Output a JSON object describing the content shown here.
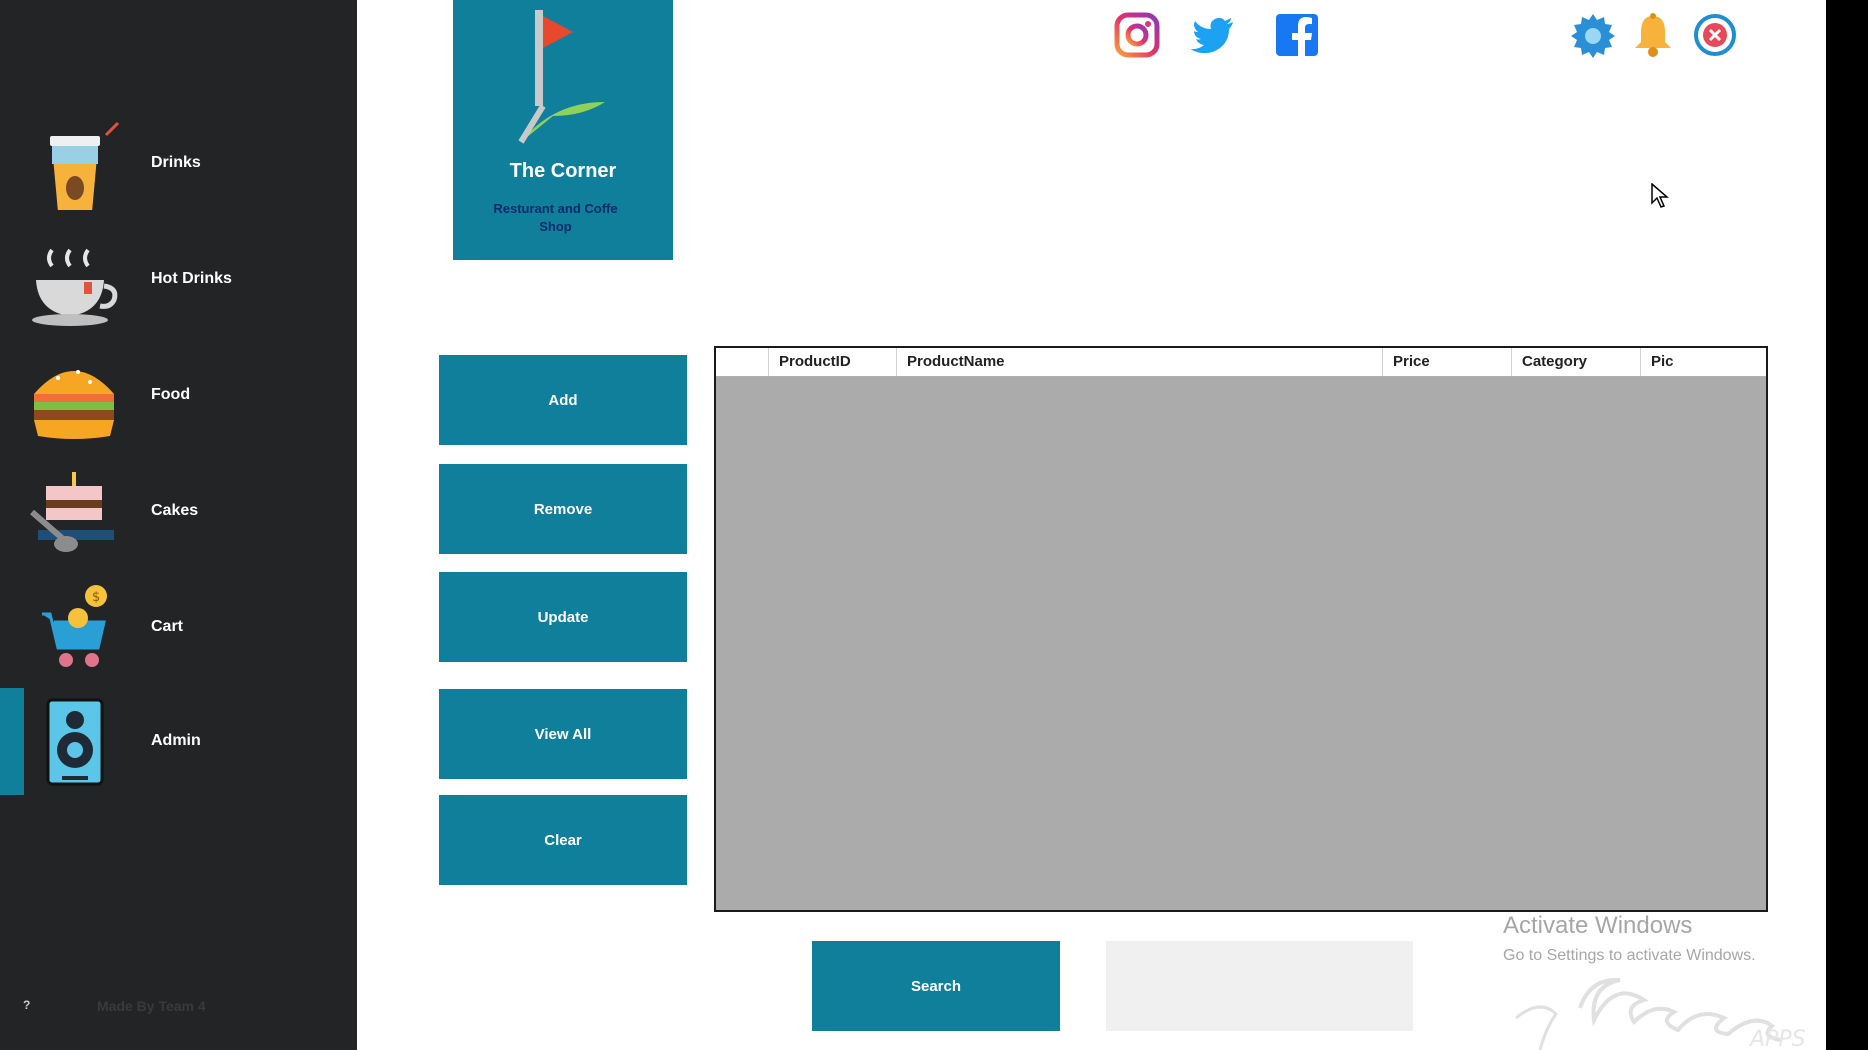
{
  "sidebar": {
    "items": [
      {
        "label": "Drinks",
        "icon": "drink-cup-icon"
      },
      {
        "label": "Hot Drinks",
        "icon": "hot-cup-icon"
      },
      {
        "label": "Food",
        "icon": "burger-icon"
      },
      {
        "label": "Cakes",
        "icon": "cake-icon"
      },
      {
        "label": "Cart",
        "icon": "cart-icon"
      },
      {
        "label": "Admin",
        "icon": "admin-icon",
        "selected": true
      }
    ],
    "help": "?",
    "credit": "Made By Team 4"
  },
  "logo": {
    "title": "The Corner",
    "subtitle": "Resturant and Coffe Shop"
  },
  "header_icons": [
    "instagram-icon",
    "twitter-icon",
    "facebook-icon",
    "settings-icon",
    "bell-icon",
    "close-icon"
  ],
  "actions": {
    "add": "Add",
    "remove": "Remove",
    "update": "Update",
    "view_all": "View All",
    "clear": "Clear"
  },
  "table": {
    "columns": [
      "ProductID",
      "ProductName",
      "Price",
      "Category",
      "Pic"
    ],
    "rows": []
  },
  "search": {
    "button": "Search",
    "value": ""
  },
  "watermark": {
    "line1": "Activate Windows",
    "line2": "Go to Settings to activate Windows."
  },
  "colors": {
    "accent": "#0f7f9c",
    "sidebar_bg": "#232426",
    "grid_bg": "#ababab"
  }
}
